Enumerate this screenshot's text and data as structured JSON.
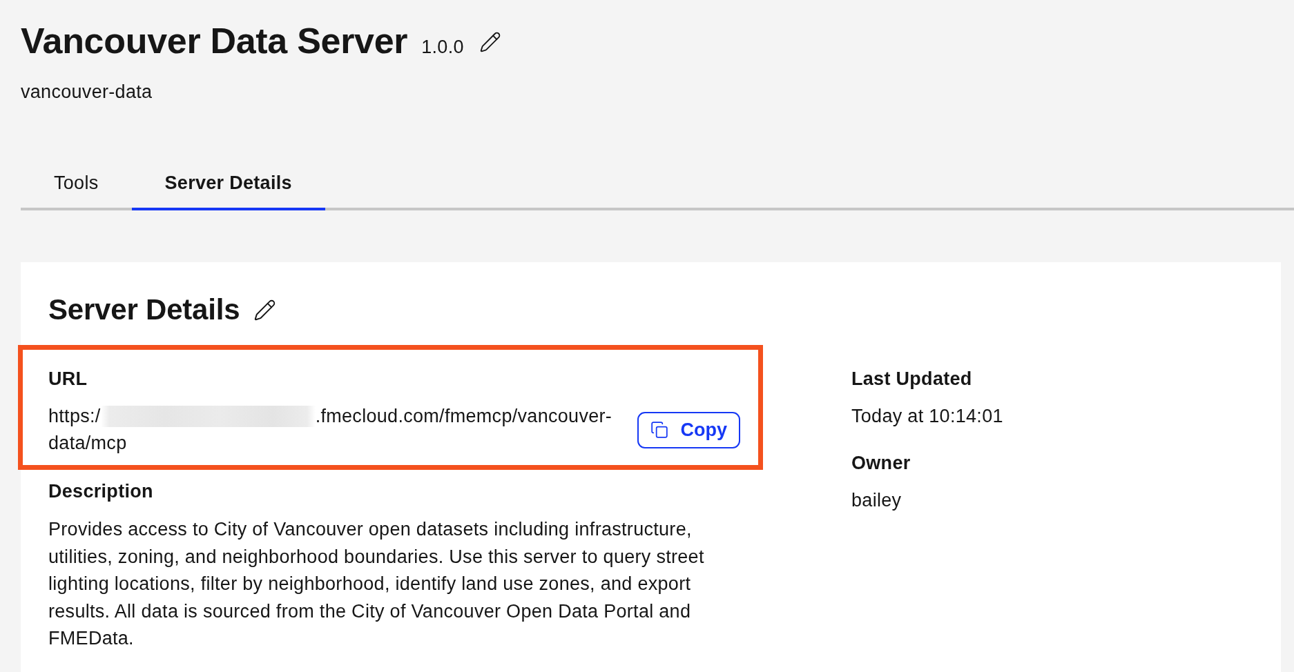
{
  "header": {
    "title": "Vancouver Data Server",
    "version": "1.0.0",
    "slug": "vancouver-data"
  },
  "tabs": [
    {
      "label": "Tools",
      "selected": false
    },
    {
      "label": "Server Details",
      "selected": true
    }
  ],
  "details_card": {
    "title": "Server Details",
    "url": {
      "label": "URL",
      "prefix": "https:/",
      "suffix": ".fmecloud.com/fmemcp/vancouver-data/mcp",
      "copy_button": "Copy",
      "highlighted": true
    },
    "description": {
      "label": "Description",
      "text": "Provides access to City of Vancouver open datasets including infrastructure, utilities, zoning, and neighborhood boundaries. Use this server to query street lighting locations, filter by neighborhood, identify land use zones, and export results. All data is sourced from the City of Vancouver Open Data Portal and FMEData."
    },
    "meta": [
      {
        "label": "Last Updated",
        "value": "Today at 10:14:01"
      },
      {
        "label": "Owner",
        "value": "bailey"
      }
    ]
  }
}
